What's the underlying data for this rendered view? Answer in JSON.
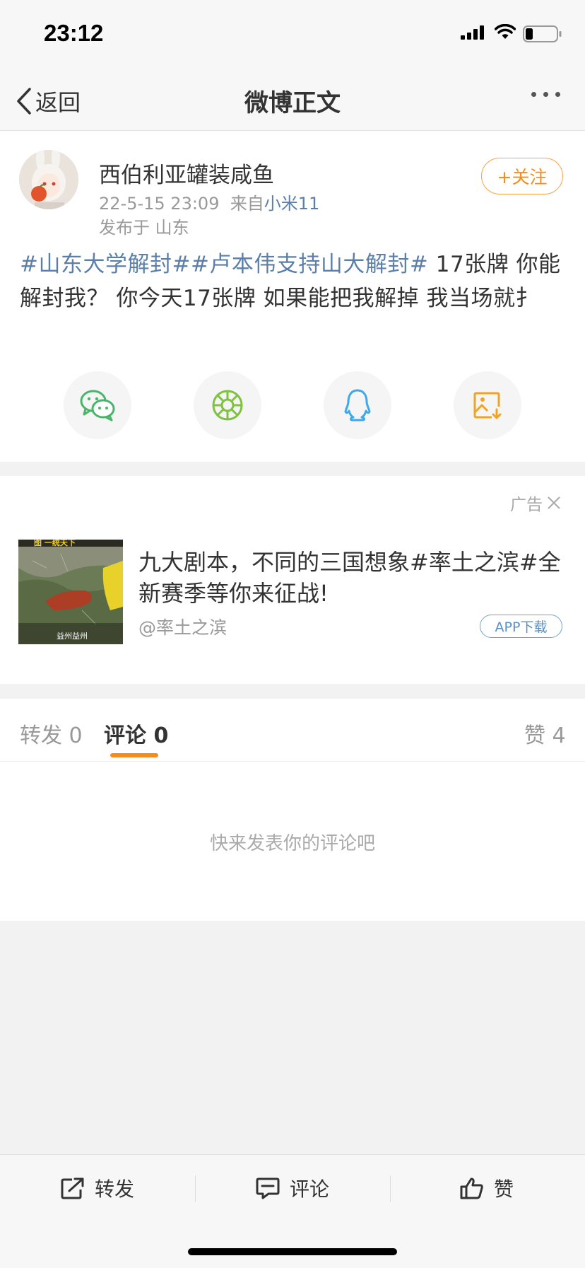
{
  "status_bar": {
    "time": "23:12"
  },
  "nav": {
    "back_label": "返回",
    "title": "微博正文"
  },
  "post": {
    "username": "西伯利亚罐装咸鱼",
    "date": "22-5-15 23:09",
    "source_prefix": "来自",
    "source": "小米11",
    "location": "发布于 山东",
    "follow_label": "+关注",
    "tag1": "#山东大学解封#",
    "tag2": "#卢本伟支持山大解封#",
    "body": " 17张牌  你能解封我？   你今天17张牌  如果能把我解掉  我当场就扌",
    "share_icons": [
      "wechat-icon",
      "moments-icon",
      "qq-icon",
      "save-image-icon"
    ]
  },
  "ad": {
    "label": "广告",
    "title": "九大剧本，不同的三国想象#率土之滨#全新赛季等你来征战!",
    "author": "@率土之滨",
    "app_download": "APP下载",
    "image_caption": "益州益州",
    "image_banner": "图 一统天下"
  },
  "tabs": {
    "repost": "转发",
    "repost_count": "0",
    "comment": "评论",
    "comment_count": "0",
    "like": "赞",
    "like_count": "4"
  },
  "comments": {
    "empty_text": "快来发表你的评论吧"
  },
  "toolbar": {
    "repost": "转发",
    "comment": "评论",
    "like": "赞"
  },
  "colors": {
    "link": "#5b7fa8",
    "accent": "#f58d1e",
    "app_download": "#5b8fc4"
  }
}
